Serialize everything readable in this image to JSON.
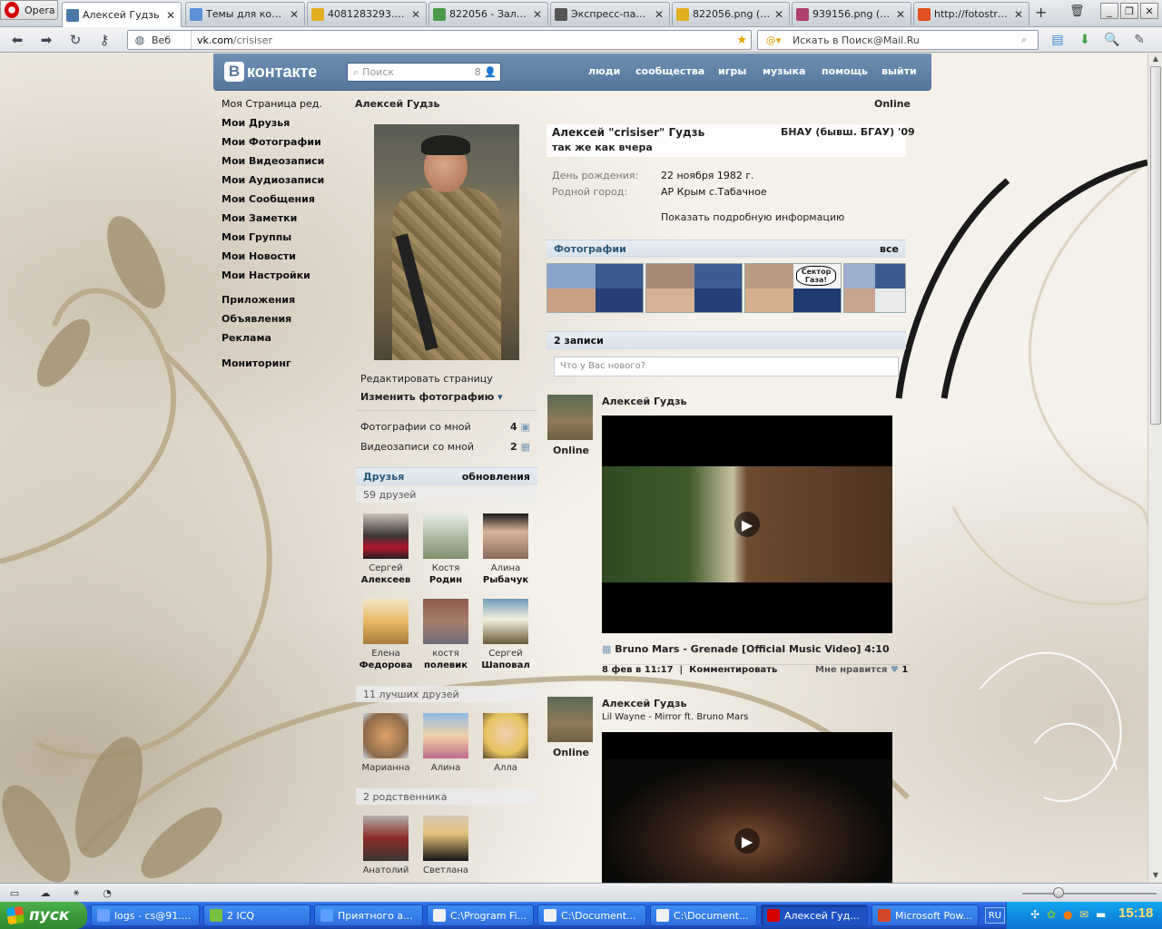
{
  "browser": {
    "menu_button": "Opera",
    "tabs": [
      {
        "label": "Алексей Гудзь",
        "icon": "vk-icon",
        "color": "#4a76a8"
      },
      {
        "label": "Темы для конта...",
        "icon": "forum-icon",
        "color": "#5b8fd6"
      },
      {
        "label": "4081283293.png...",
        "icon": "image-icon",
        "color": "#e0b020"
      },
      {
        "label": "822056 - Заливк...",
        "icon": "folder-icon",
        "color": "#4a9a4a"
      },
      {
        "label": "Экспресс-панель",
        "icon": "speed-dial-icon",
        "color": "#555555"
      },
      {
        "label": "822056.png (128...",
        "icon": "image-icon",
        "color": "#e0b020"
      },
      {
        "label": "939156.png (128...",
        "icon": "image-icon",
        "color": "#b04070"
      },
      {
        "label": "http://fotostrana...",
        "icon": "fotostrana-icon",
        "color": "#e05020"
      }
    ],
    "address": {
      "scheme_label": "Веб",
      "host": "vk.com",
      "path": "/crisiser"
    },
    "search_placeholder": "Искать в Поиск@Mail.Ru"
  },
  "vk": {
    "logo_text": "контакте",
    "logo_letter": "В",
    "search_placeholder": "Поиск",
    "search_count": "8",
    "nav": [
      "люди",
      "сообщества",
      "игры",
      "музыка",
      "помощь",
      "выйти"
    ],
    "left_menu": {
      "my_page": "Моя Страница",
      "edit": "ред.",
      "items": [
        "Мои Друзья",
        "Мои Фотографии",
        "Мои Видеозаписи",
        "Мои Аудиозаписи",
        "Мои Сообщения",
        "Мои Заметки",
        "Мои Группы",
        "Мои Новости",
        "Мои Настройки"
      ],
      "extra": [
        "Приложения",
        "Объявления",
        "Реклама"
      ],
      "monitoring": "Мониторинг"
    },
    "profile_header_name": "Алексей Гудзь",
    "status_online": "Online",
    "profile": {
      "full_name": "Алексей \"crisiser\" Гудзь",
      "university": "БНАУ (бывш. БГАУ) '09",
      "status_text": "так же как вчера",
      "info": [
        {
          "key": "День рождения:",
          "value": "22 ноября 1982 г."
        },
        {
          "key": "Родной город:",
          "value": "АР Крым с.Табачное"
        }
      ],
      "show_more": "Показать подробную информацию"
    },
    "under_avatar": {
      "edit_page": "Редактировать страницу",
      "change_photo": "Изменить фотографию",
      "photos_with_me": "Фотографии со мной",
      "photos_with_me_count": "4",
      "videos_with_me": "Видеозаписи со мной",
      "videos_with_me_count": "2"
    },
    "friends": {
      "title": "Друзья",
      "updates": "обновления",
      "count_text": "59 друзей",
      "list": [
        {
          "first": "Сергей",
          "last": "Алексеев"
        },
        {
          "first": "Костя",
          "last": "Родин"
        },
        {
          "first": "Алина",
          "last": "Рыбачук"
        },
        {
          "first": "Елена",
          "last": "Федорова"
        },
        {
          "first": "костя",
          "last": "полевик"
        },
        {
          "first": "Сергей",
          "last": "Шаповал"
        }
      ],
      "best_title": "11 лучших друзей",
      "best": [
        "Марианна",
        "Алина",
        "Алла"
      ],
      "relatives_title": "2 родственника",
      "relatives": [
        "Анатолий",
        "Светлана"
      ]
    },
    "photos": {
      "title": "Фотографии",
      "all": "все",
      "thumb_text": "Сектор Газа!"
    },
    "wall": {
      "count_title": "2 записи",
      "input_placeholder": "Что у Вас нового?",
      "posts": [
        {
          "author": "Алексей Гудзь",
          "online": "Online",
          "video_title": "Bruno Mars - Grenade [Official Music Video] 4:10",
          "date": "8 фев в 11:17",
          "comment": "Комментировать",
          "like": "Мне нравится",
          "like_count": "1"
        },
        {
          "author": "Алексей Гудзь",
          "online": "Online",
          "subtitle": "Lil Wayne - Mirror ft. Bruno Mars"
        }
      ]
    }
  },
  "taskbar": {
    "start": "пуск",
    "tasks": [
      {
        "label": "logs - cs@91....",
        "color": "#6aa0ff"
      },
      {
        "label": "2 ICQ",
        "color": "#7ac142"
      },
      {
        "label": "Приятного а...",
        "color": "#5aa0ff"
      },
      {
        "label": "C:\\Program Fi...",
        "color": "#f0f0f0"
      },
      {
        "label": "C:\\Document...",
        "color": "#f0f0f0"
      },
      {
        "label": "C:\\Document...",
        "color": "#f0f0f0"
      },
      {
        "label": "Алексей Гуд...",
        "color": "#d40000"
      },
      {
        "label": "Microsoft Pow...",
        "color": "#d24726"
      }
    ],
    "lang": "RU",
    "clock": "15:18"
  }
}
